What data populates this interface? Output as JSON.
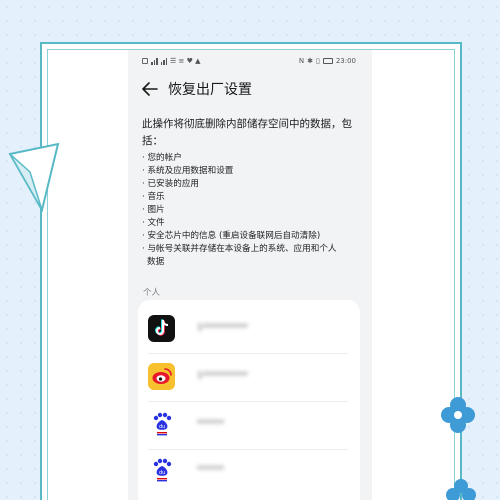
{
  "status_bar": {
    "left": "☰ ≡ ♥ ▲",
    "time": "23:00"
  },
  "header": {
    "back_icon": "back-arrow-icon",
    "title": "恢复出厂设置"
  },
  "description": "此操作将彻底删除内部储存空间中的数据，包括：",
  "bullets": [
    "· 您的帐户",
    "· 系统及应用数据和设置",
    "· 已安装的应用",
    "· 音乐",
    "· 图片",
    "· 文件",
    "· 安全芯片中的信息 (重启设备联网后自动清除)",
    "· 与帐号关联并存储在本设备上的系统、应用和个人\n数据"
  ],
  "section_label": "个人",
  "apps": [
    {
      "icon": "tiktok-icon",
      "name": "1**********"
    },
    {
      "icon": "weibo-icon",
      "name": "1**********"
    },
    {
      "icon": "baidu-icon",
      "name": "******"
    },
    {
      "icon": "baidu-icon",
      "name": "******"
    }
  ],
  "colors": {
    "background": "#e4f0fb",
    "frame_border": "#57b9c6",
    "phone_bg": "#f1f3f5",
    "decor_blue": "#3e9bd6"
  }
}
